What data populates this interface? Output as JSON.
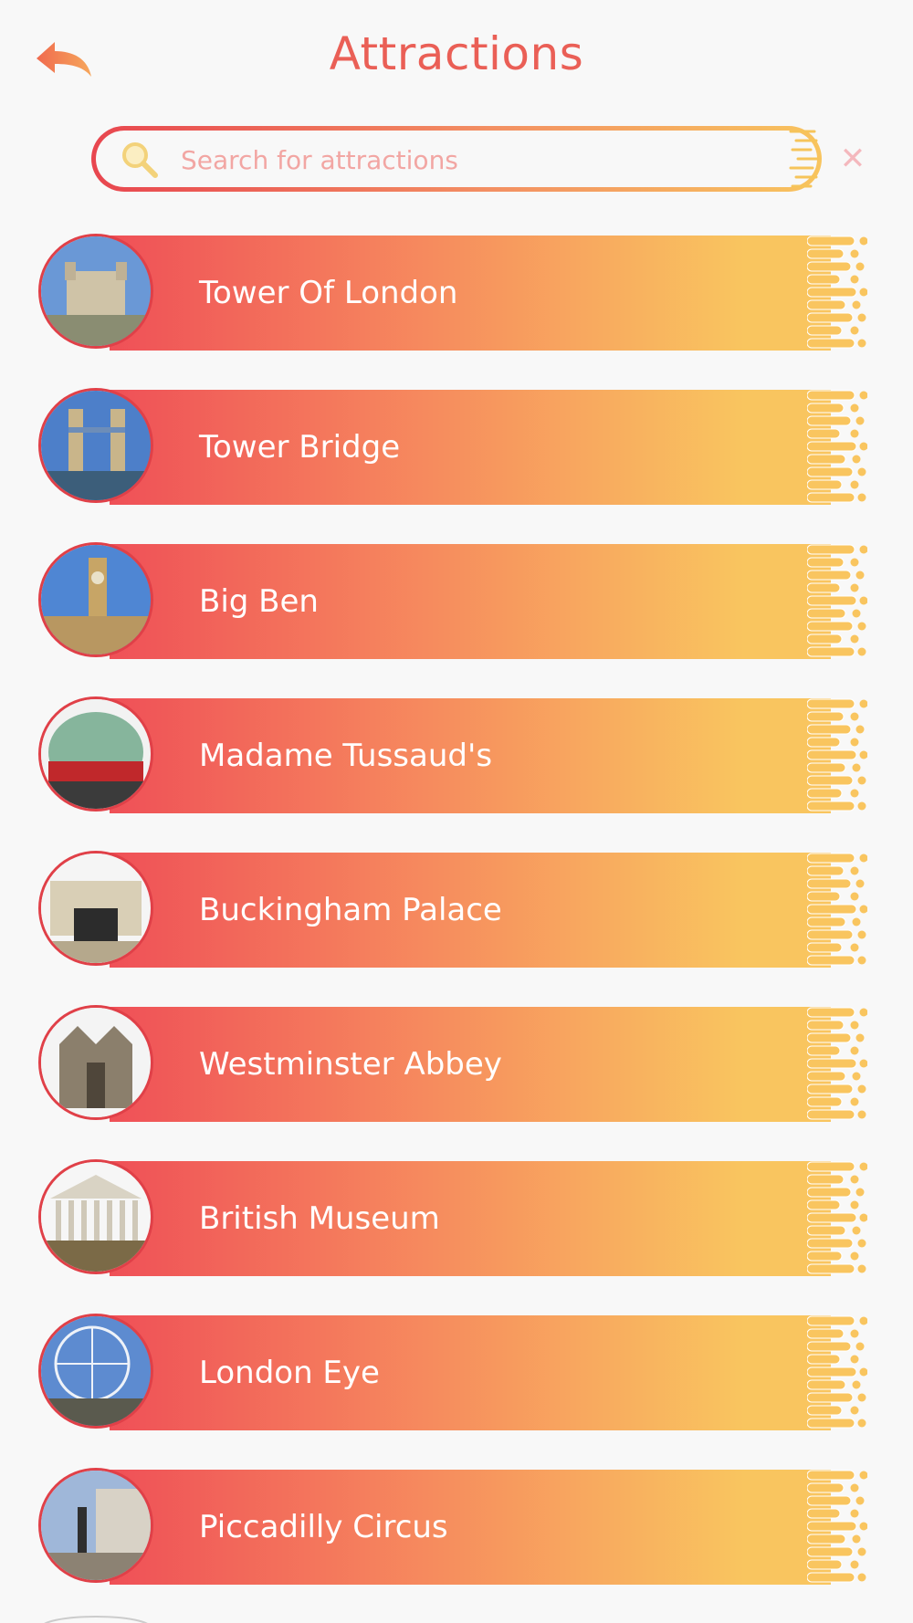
{
  "header": {
    "title": "Attractions"
  },
  "search": {
    "placeholder": "Search for attractions",
    "value": ""
  },
  "colors": {
    "accent": "#ea5f56",
    "gradient_start": "#ef5057",
    "gradient_end": "#f9c55f",
    "thumb_border": "#e04048",
    "background": "#f8f8f8"
  },
  "icons": {
    "back": "back-arrow-icon",
    "search": "magnifier-icon",
    "clear": "close-x-icon"
  },
  "attractions": [
    {
      "name": "Tower Of London",
      "thumb": "castle-photo"
    },
    {
      "name": "Tower Bridge",
      "thumb": "bridge-photo"
    },
    {
      "name": "Big Ben",
      "thumb": "clocktower-photo"
    },
    {
      "name": "Madame Tussaud's",
      "thumb": "dome-photo"
    },
    {
      "name": "Buckingham Palace",
      "thumb": "palace-photo"
    },
    {
      "name": "Westminster Abbey",
      "thumb": "abbey-photo"
    },
    {
      "name": "British Museum",
      "thumb": "museum-photo"
    },
    {
      "name": "London Eye",
      "thumb": "ferris-wheel-photo"
    },
    {
      "name": "Piccadilly Circus",
      "thumb": "plaza-photo"
    }
  ]
}
